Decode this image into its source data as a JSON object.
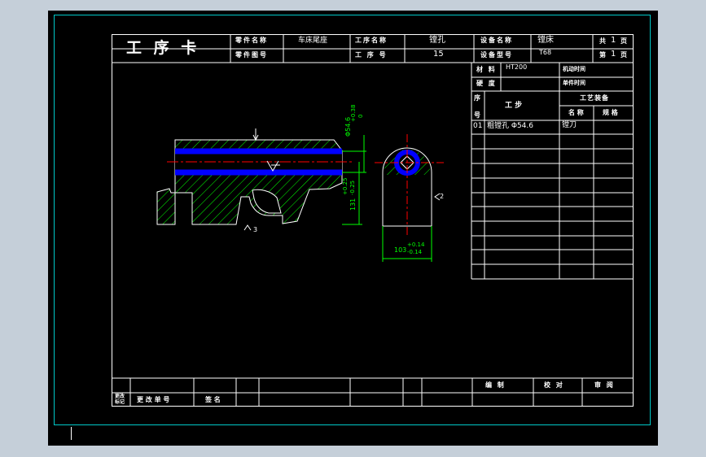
{
  "title_block": {
    "card_title": "工 序 卡",
    "part_name_label": "零件名称",
    "part_name_value": "车床尾座",
    "part_no_label": "零件图号",
    "process_name_label": "工序名称",
    "process_name_value": "镗孔",
    "process_no_label": "工 序 号",
    "process_no_value": "15",
    "equip_name_label": "设备名称",
    "equip_name_value": "镗床",
    "equip_model_label": "设备型号",
    "equip_model_value": "T68",
    "total_label_pre": "共",
    "total_value": "1",
    "total_label_post": "页",
    "page_label_pre": "第",
    "page_value": "1",
    "page_label_post": "页"
  },
  "right_table": {
    "material_label": "材 料",
    "material_value": "HT200",
    "machine_time_label": "机动时间",
    "hardness_label": "硬 度",
    "unit_time_label": "单件时间",
    "seq_label_top": "序",
    "seq_label_bottom": "号",
    "step_label": "工  步",
    "equipment_label": "工艺装备",
    "name_label": "名 称",
    "spec_label": "规 格",
    "rows": [
      {
        "seq": "01",
        "step": "粗镗孔 Φ54.6",
        "tool": "镗刀"
      }
    ]
  },
  "footer": {
    "mark_label_1": "更改",
    "mark_label_2": "标记",
    "change_no_label": "更 改 单 号",
    "signature_label": "签 名",
    "compile_label": "编 制",
    "check_label": "校 对",
    "review_label": "审 阅"
  },
  "dimensions": {
    "bore_dia": "Φ54.6",
    "bore_tol_upper": "+0.38",
    "bore_tol_lower": "0",
    "height_val": "131",
    "height_tol_upper": "+0.25",
    "height_tol_lower": "-0.25",
    "width_val": "103",
    "width_tol_upper": "+0.14",
    "width_tol_lower": "-0.14",
    "datum_mark_side": "2",
    "datum_mark_bottom": "3"
  },
  "colors": {
    "background": "#000000",
    "line": "#ffffff",
    "hatch": "#00ff00",
    "dimension": "#00ff00",
    "centerline": "#ff0000",
    "bore_highlight": "#0000ff",
    "frame": "#00c8c8"
  }
}
